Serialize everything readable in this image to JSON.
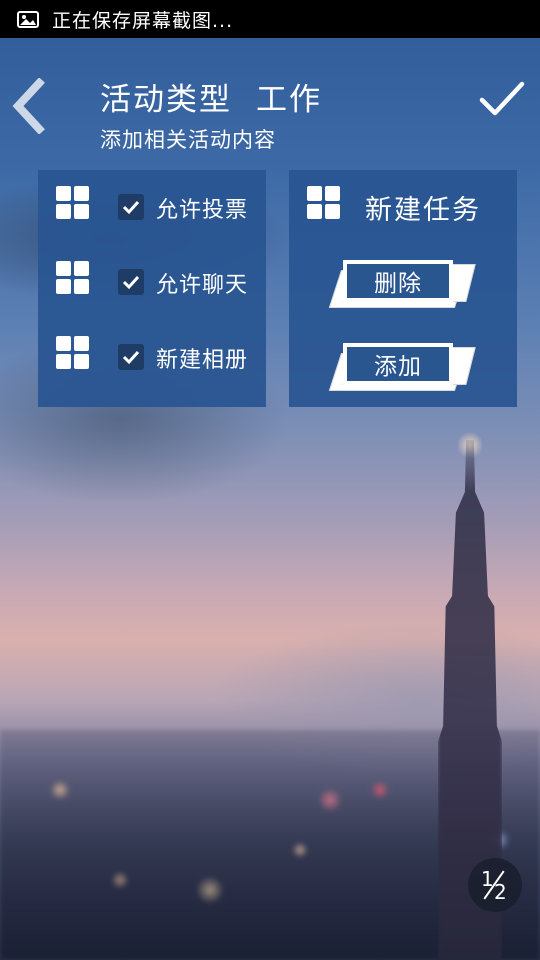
{
  "status_bar": {
    "icon": "image-icon",
    "text": "正在保存屏幕截图..."
  },
  "header": {
    "back_icon": "chevron-left-icon",
    "title_prefix": "活动类型",
    "title_value": "工作",
    "subtitle": "添加相关活动内容",
    "confirm_icon": "checkmark-icon"
  },
  "options_panel": {
    "items": [
      {
        "label": "允许投票",
        "checked": true,
        "icon": "grid-icon"
      },
      {
        "label": "允许聊天",
        "checked": true,
        "icon": "grid-icon"
      },
      {
        "label": "新建相册",
        "checked": true,
        "icon": "grid-icon"
      }
    ]
  },
  "task_panel": {
    "icon": "grid-icon",
    "title": "新建任务",
    "delete_label": "删除",
    "add_label": "添加"
  },
  "page_indicator": {
    "current": "1",
    "total": "2"
  },
  "colors": {
    "panel": "#285591",
    "status_bar": "#000000",
    "checkbox": "#1f3c66"
  }
}
